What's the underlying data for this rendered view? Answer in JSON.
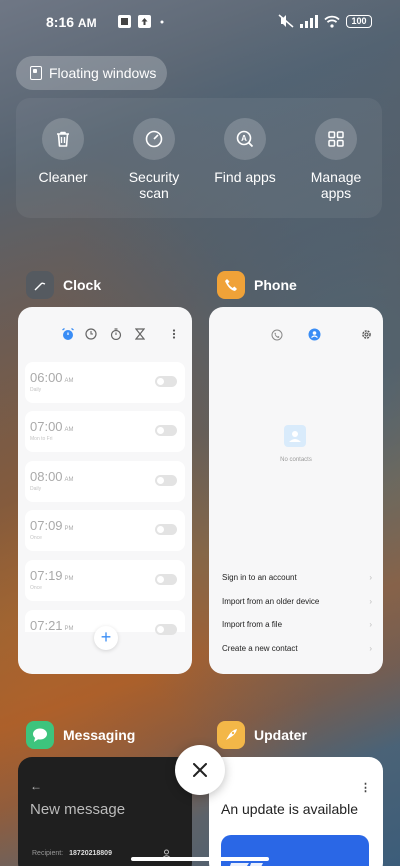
{
  "status_bar": {
    "time": "8:16",
    "ampm": "AM",
    "battery": "100"
  },
  "floating_windows": {
    "label": "Floating windows"
  },
  "quick_actions": [
    {
      "label": "Cleaner",
      "icon": "trash-icon"
    },
    {
      "label": "Security scan",
      "icon": "security-scan-icon"
    },
    {
      "label": "Find apps",
      "icon": "find-apps-icon"
    },
    {
      "label": "Manage apps",
      "icon": "grid-icon"
    }
  ],
  "apps": {
    "clock": {
      "name": "Clock",
      "alarms": [
        {
          "time": "06:00",
          "ampm": "AM",
          "sub": "Daily"
        },
        {
          "time": "07:00",
          "ampm": "AM",
          "sub": "Mon to Fri"
        },
        {
          "time": "08:00",
          "ampm": "AM",
          "sub": "Daily"
        },
        {
          "time": "07:09",
          "ampm": "PM",
          "sub": "Once"
        },
        {
          "time": "07:19",
          "ampm": "PM",
          "sub": "Once"
        },
        {
          "time": "07:21",
          "ampm": "PM",
          "sub": ""
        }
      ],
      "add_label": "+"
    },
    "phone": {
      "name": "Phone",
      "empty_label": "No contacts",
      "options": [
        "Sign in to an account",
        "Import from an older device",
        "Import from a file",
        "Create a new contact"
      ]
    },
    "messaging": {
      "name": "Messaging",
      "title": "New message",
      "recipient_label": "Recipient:",
      "recipient_number": "18720218809"
    },
    "updater": {
      "name": "Updater",
      "title": "An update is available"
    }
  },
  "colors": {
    "accent_blue": "#3a8df5",
    "clock_icon_bg": "#555a60",
    "phone_icon_bg": "#f0a238",
    "messaging_icon_bg": "#3dc47d",
    "updater_icon_bg": "#f3b748"
  }
}
